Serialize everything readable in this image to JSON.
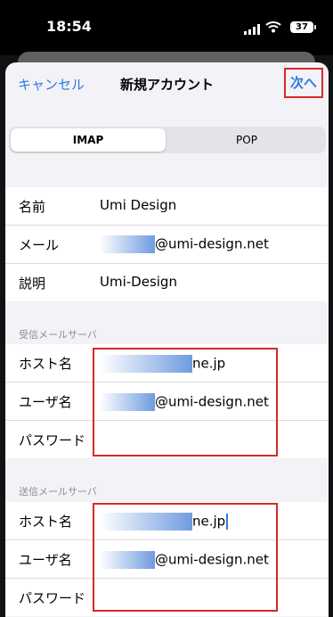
{
  "status_bar": {
    "time": "18:54",
    "battery": "37"
  },
  "nav": {
    "cancel_label": "キャンセル",
    "title": "新規アカウント",
    "next_label": "次へ"
  },
  "segments": {
    "imap": "IMAP",
    "pop": "POP"
  },
  "account": {
    "name_label": "名前",
    "name_value": "Umi Design",
    "mail_label": "メール",
    "mail_value": "@umi-design.net",
    "desc_label": "説明",
    "desc_value": "Umi-Design"
  },
  "incoming": {
    "header": "受信メールサーバ",
    "host_label": "ホスト名",
    "host_value": "ne.jp",
    "user_label": "ユーザ名",
    "user_value": "@umi-design.net",
    "password_label": "パスワード"
  },
  "outgoing": {
    "header": "送信メールサーバ",
    "host_label": "ホスト名",
    "host_value": "ne.jp",
    "user_label": "ユーザ名",
    "user_value": "@umi-design.net",
    "password_label": "パスワード"
  },
  "colors": {
    "accent": "#2f7be0",
    "highlight_box": "#d42a2a",
    "background": "#f2f2f7"
  }
}
